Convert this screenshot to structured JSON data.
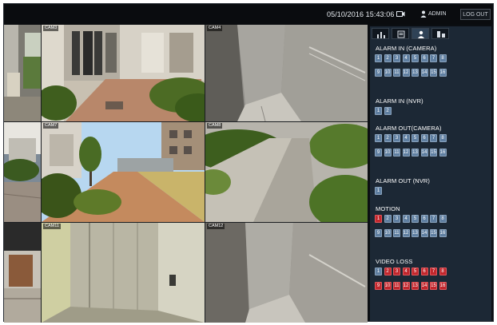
{
  "topbar": {
    "datetime": "05/10/2016 15:43:06",
    "user": "ADMIN",
    "logout_label": "LOG OUT",
    "icons": [
      "recording-icon",
      "user-icon"
    ]
  },
  "cameras": [
    {
      "label": ""
    },
    {
      "label": "CAM3"
    },
    {
      "label": "CAM4"
    },
    {
      "label": ""
    },
    {
      "label": "CAM7"
    },
    {
      "label": "CAM8"
    },
    {
      "label": ""
    },
    {
      "label": "CAM11"
    },
    {
      "label": "CAM12"
    }
  ],
  "sidebar": {
    "tabs": [
      {
        "name": "alarm-stats-tab",
        "icon": "chart-icon"
      },
      {
        "name": "log-tab",
        "icon": "document-icon"
      },
      {
        "name": "user-tab",
        "icon": "user-icon",
        "active": true
      },
      {
        "name": "device-tab",
        "icon": "device-icon"
      }
    ],
    "sections": [
      {
        "title": "ALARM IN (CAMERA)",
        "items": [
          "1",
          "2",
          "3",
          "4",
          "5",
          "6",
          "7",
          "8",
          "9",
          "10",
          "11",
          "12",
          "13",
          "14",
          "15",
          "16"
        ],
        "active": []
      },
      {
        "title": "ALARM IN (NVR)",
        "items": [
          "1",
          "2"
        ],
        "active": []
      },
      {
        "title": "ALARM OUT(CAMERA)",
        "items": [
          "1",
          "2",
          "3",
          "4",
          "5",
          "6",
          "7",
          "8",
          "9",
          "10",
          "11",
          "12",
          "13",
          "14",
          "15",
          "16"
        ],
        "active": []
      },
      {
        "title": "ALARM OUT (NVR)",
        "items": [
          "1"
        ],
        "active": []
      },
      {
        "title": "MOTION",
        "items": [
          "1",
          "2",
          "3",
          "4",
          "5",
          "6",
          "7",
          "8",
          "9",
          "10",
          "11",
          "12",
          "13",
          "14",
          "15",
          "16"
        ],
        "active": [
          "1"
        ]
      },
      {
        "title": "VIDEO LOSS",
        "items": [
          "1",
          "2",
          "3",
          "4",
          "5",
          "6",
          "7",
          "8",
          "9",
          "10",
          "11",
          "12",
          "13",
          "14",
          "15",
          "16"
        ],
        "active": [
          "2",
          "3",
          "4",
          "5",
          "6",
          "7",
          "8",
          "9",
          "10",
          "11",
          "12",
          "13",
          "14",
          "15",
          "16"
        ]
      }
    ],
    "colors": {
      "badge": "#5f7fa1",
      "badge_alert": "#c1272d",
      "panel": "#1c2835"
    }
  }
}
